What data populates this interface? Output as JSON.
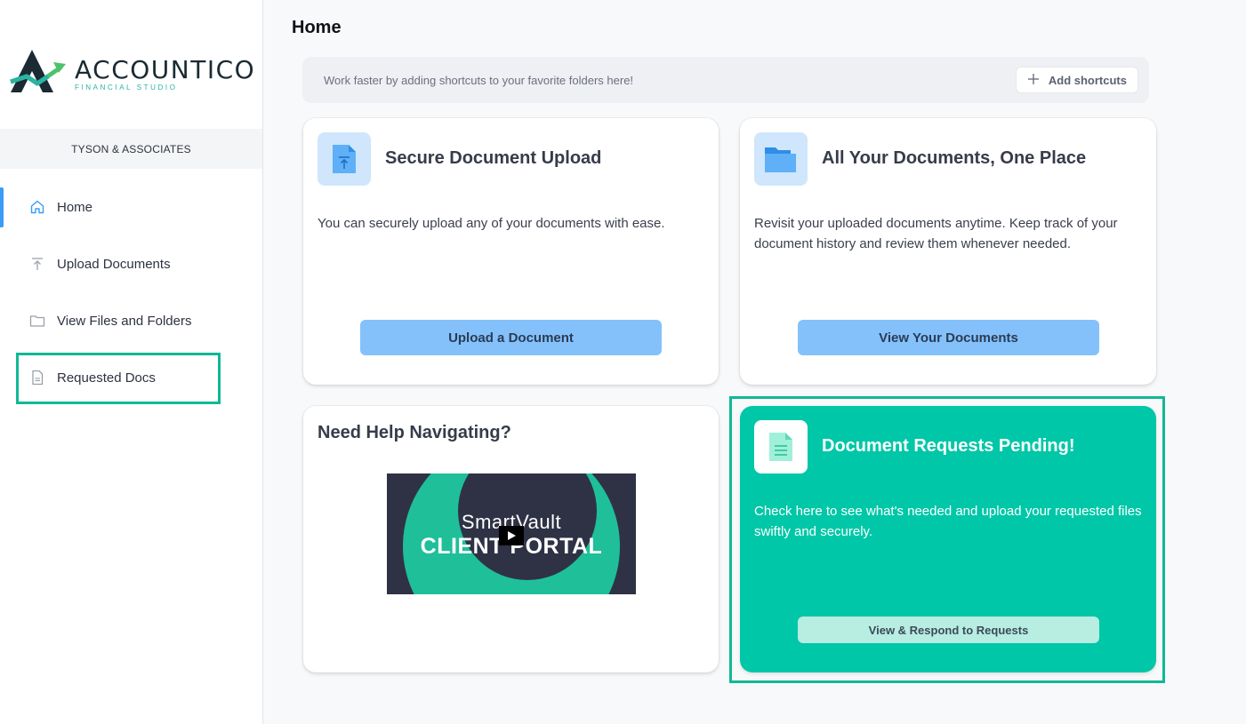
{
  "brand": {
    "name": "ACCOUNTICO",
    "tagline": "FINANCIAL STUDIO",
    "colors": {
      "dark": "#1b2a33",
      "accent": "#2bb3a3",
      "green_arrow": "#4cc36a"
    }
  },
  "sidebar": {
    "org_name": "TYSON & ASSOCIATES",
    "items": [
      {
        "label": "Home",
        "icon": "home-icon",
        "active": true
      },
      {
        "label": "Upload Documents",
        "icon": "upload-icon",
        "active": false
      },
      {
        "label": "View Files and Folders",
        "icon": "folder-icon",
        "active": false
      },
      {
        "label": "Requested Docs",
        "icon": "document-icon",
        "active": false
      }
    ]
  },
  "main": {
    "title": "Home",
    "shortcuts": {
      "message": "Work faster by adding shortcuts to your favorite folders here!",
      "button_label": "Add shortcuts"
    },
    "cards": {
      "upload": {
        "title": "Secure Document Upload",
        "text": "You can securely upload any of your documents with ease.",
        "button": "Upload a Document",
        "icon": "file-upload-icon"
      },
      "documents": {
        "title": "All Your Documents, One Place",
        "text": "Revisit your uploaded documents anytime. Keep track of your document history and review them whenever needed.",
        "button": "View Your Documents",
        "icon": "folder-icon"
      },
      "help": {
        "title": "Need Help Navigating?",
        "video_line1": "SmartVault",
        "video_line2": "CLIENT PORTAL",
        "icon": "play-icon"
      },
      "requests": {
        "title": "Document Requests Pending!",
        "text": "Check here to see what's needed and upload your requested files swiftly and securely.",
        "button": "View & Respond to Requests",
        "icon": "document-lines-icon"
      }
    }
  },
  "colors": {
    "primary_button": "#84c1fb",
    "green_card": "#00c7a7",
    "highlight": "#11b896",
    "active_indicator": "#3b9cf5"
  }
}
